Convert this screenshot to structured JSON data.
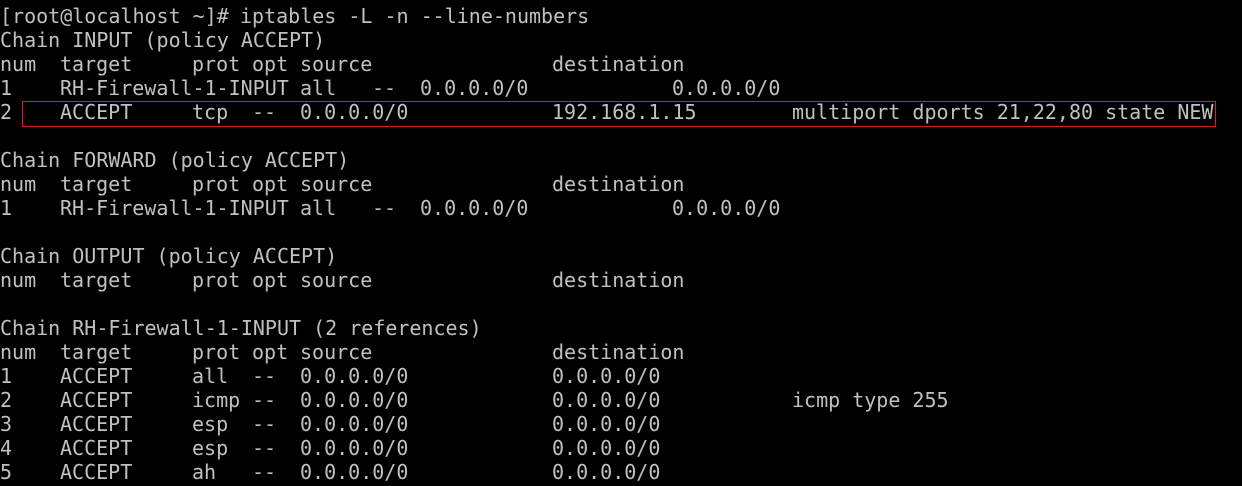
{
  "terminal": {
    "top_remnant": "[",
    "prompt": "[root@localhost ~]# ",
    "command": "iptables -L -n --line-numbers",
    "input_chain": {
      "header": "Chain INPUT (policy ACCEPT)",
      "columns": [
        "num",
        "target",
        "prot",
        "opt",
        "source",
        "destination"
      ],
      "rows": [
        {
          "num": "1",
          "target": "RH-Firewall-1-INPUT",
          "prot": "all",
          "opt": "--",
          "source": "0.0.0.0/0",
          "destination": "0.0.0.0/0",
          "extra": ""
        },
        {
          "num": "2",
          "target": "ACCEPT",
          "prot": "tcp",
          "opt": "--",
          "source": "0.0.0.0/0",
          "destination": "192.168.1.15",
          "extra": "multiport dports 21,22,80 state NEW"
        }
      ]
    },
    "forward_chain": {
      "header": "Chain FORWARD (policy ACCEPT)",
      "columns": [
        "num",
        "target",
        "prot",
        "opt",
        "source",
        "destination"
      ],
      "rows": [
        {
          "num": "1",
          "target": "RH-Firewall-1-INPUT",
          "prot": "all",
          "opt": "--",
          "source": "0.0.0.0/0",
          "destination": "0.0.0.0/0",
          "extra": ""
        }
      ]
    },
    "output_chain": {
      "header": "Chain OUTPUT (policy ACCEPT)",
      "columns": [
        "num",
        "target",
        "prot",
        "opt",
        "source",
        "destination"
      ],
      "rows": []
    },
    "rh_chain": {
      "header": "Chain RH-Firewall-1-INPUT (2 references)",
      "columns": [
        "num",
        "target",
        "prot",
        "opt",
        "source",
        "destination"
      ],
      "rows": [
        {
          "num": "1",
          "target": "ACCEPT",
          "prot": "all",
          "opt": "--",
          "source": "0.0.0.0/0",
          "destination": "0.0.0.0/0",
          "extra": ""
        },
        {
          "num": "2",
          "target": "ACCEPT",
          "prot": "icmp",
          "opt": "--",
          "source": "0.0.0.0/0",
          "destination": "0.0.0.0/0",
          "extra": "icmp type 255"
        },
        {
          "num": "3",
          "target": "ACCEPT",
          "prot": "esp",
          "opt": "--",
          "source": "0.0.0.0/0",
          "destination": "0.0.0.0/0",
          "extra": ""
        },
        {
          "num": "4",
          "target": "ACCEPT",
          "prot": "esp",
          "opt": "--",
          "source": "0.0.0.0/0",
          "destination": "0.0.0.0/0",
          "extra": ""
        },
        {
          "num": "5",
          "target": "ACCEPT",
          "prot": "ah",
          "opt": "--",
          "source": "0.0.0.0/0",
          "destination": "0.0.0.0/0",
          "extra": ""
        }
      ]
    },
    "colors": {
      "background": "#000000",
      "text": "#c0c0c0",
      "highlight_border": "#d62020"
    }
  }
}
